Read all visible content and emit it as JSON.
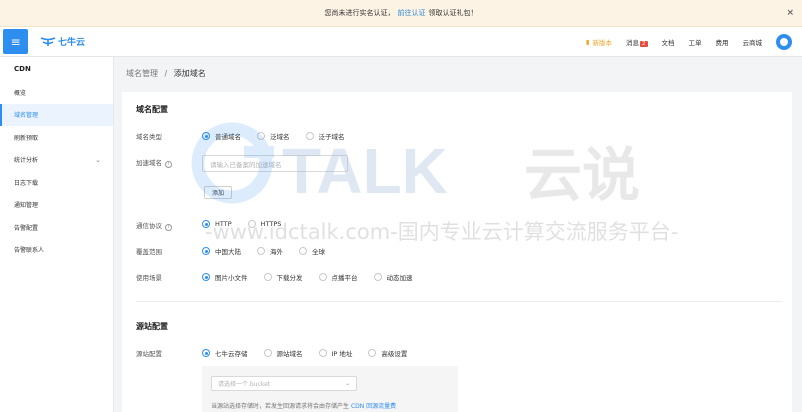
{
  "notice": {
    "text": "您尚未进行实名认证，",
    "link": "前往认证",
    "suffix": "领取认证礼包！",
    "close": "×"
  },
  "topbar": {
    "menu_icon": "≡",
    "logo_text": "七牛云",
    "nav": {
      "new": "新版本",
      "messages": "消息",
      "message_count": "2",
      "docs": "文档",
      "tickets": "工单",
      "billing": "费用",
      "console": "云商城"
    }
  },
  "sidebar": {
    "title": "CDN",
    "items": [
      {
        "label": "概览"
      },
      {
        "label": "域名管理"
      },
      {
        "label": "刷新预取"
      },
      {
        "label": "统计分析"
      },
      {
        "label": "日志下载"
      },
      {
        "label": "通知管理"
      },
      {
        "label": "告警配置"
      },
      {
        "label": "告警联系人"
      }
    ]
  },
  "breadcrumb": {
    "parent": "域名管理",
    "sep": "/",
    "current": "添加域名"
  },
  "domain_config": {
    "title": "域名配置",
    "domain_type": {
      "label": "域名类型",
      "options": [
        "普通域名",
        "泛域名",
        "泛子域名"
      ]
    },
    "accel_domain": {
      "label": "加速域名",
      "placeholder": "请输入已备案的加速域名",
      "add": "添加"
    },
    "protocol": {
      "label": "通信协议",
      "options": [
        "HTTP",
        "HTTPS"
      ]
    },
    "coverage": {
      "label": "覆盖范围",
      "options": [
        "中国大陆",
        "海外",
        "全球"
      ]
    },
    "scenario": {
      "label": "使用场景",
      "options": [
        "图片小文件",
        "下载分发",
        "点播平台",
        "动态加速"
      ]
    }
  },
  "origin_config": {
    "title": "源站配置",
    "origin": {
      "label": "源站配置",
      "options": [
        "七牛云存储",
        "源站域名",
        "IP 地址",
        "高级设置"
      ]
    },
    "bucket_placeholder": "请选择一个 bucket",
    "note": "当源站选择存储时，若发生回源请求将会由存储产生",
    "note_link": "CDN 回源流量费"
  },
  "watermark": {
    "brand": "TALK",
    "cn": "云说",
    "url": "-www.idctalk.com-国内专业云计算交流服务平台-"
  },
  "colors": {
    "accent": "#2e8ef0",
    "notice_bg": "#fdf3e4",
    "badge": "#e84d3d",
    "new_tag": "#f0a326"
  }
}
